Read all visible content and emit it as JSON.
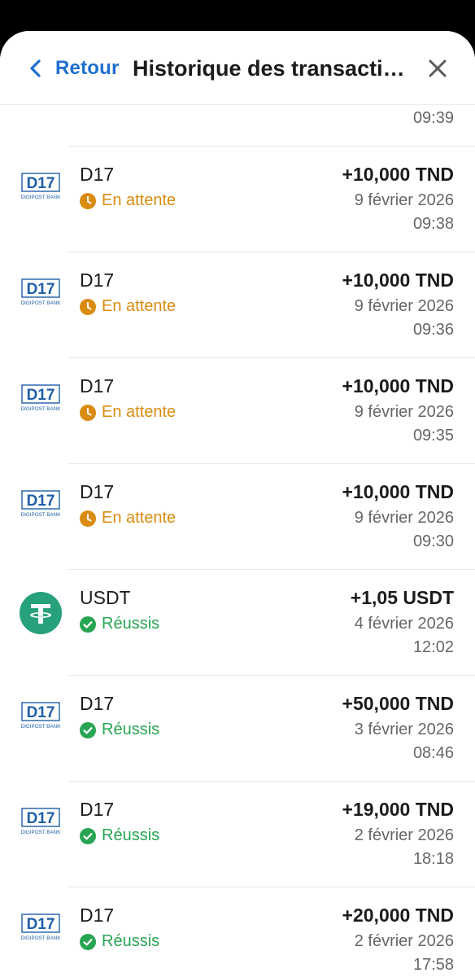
{
  "header": {
    "back_label": "Retour",
    "title": "Historique des transactio…"
  },
  "first_partial_time": "09:39",
  "transactions": [
    {
      "name": "D17",
      "logo": "d17-logo",
      "status": "En attente",
      "status_type": "pending",
      "amount": "+10,000 TND",
      "date": "9 février 2026",
      "time": "09:38"
    },
    {
      "name": "D17",
      "logo": "d17-logo",
      "status": "En attente",
      "status_type": "pending",
      "amount": "+10,000 TND",
      "date": "9 février 2026",
      "time": "09:36"
    },
    {
      "name": "D17",
      "logo": "d17-logo",
      "status": "En attente",
      "status_type": "pending",
      "amount": "+10,000 TND",
      "date": "9 février 2026",
      "time": "09:35"
    },
    {
      "name": "D17",
      "logo": "d17-logo",
      "status": "En attente",
      "status_type": "pending",
      "amount": "+10,000 TND",
      "date": "9 février 2026",
      "time": "09:30"
    },
    {
      "name": "USDT",
      "logo": "tether-logo",
      "status": "Réussis",
      "status_type": "success",
      "amount": "+1,05 USDT",
      "date": "4 février 2026",
      "time": "12:02"
    },
    {
      "name": "D17",
      "logo": "d17-logo",
      "status": "Réussis",
      "status_type": "success",
      "amount": "+50,000 TND",
      "date": "3 février 2026",
      "time": "08:46"
    },
    {
      "name": "D17",
      "logo": "d17-logo",
      "status": "Réussis",
      "status_type": "success",
      "amount": "+19,000 TND",
      "date": "2 février 2026",
      "time": "18:18"
    },
    {
      "name": "D17",
      "logo": "d17-logo",
      "status": "Réussis",
      "status_type": "success",
      "amount": "+20,000 TND",
      "date": "2 février 2026",
      "time": "17:58"
    }
  ],
  "colors": {
    "accent": "#1e6fd0",
    "pending": "#d98c10",
    "success": "#27a552",
    "tether": "#26a17b"
  },
  "logos": {
    "d17_text": "D17",
    "d17_subtext": "DIGIPOST BANK"
  }
}
